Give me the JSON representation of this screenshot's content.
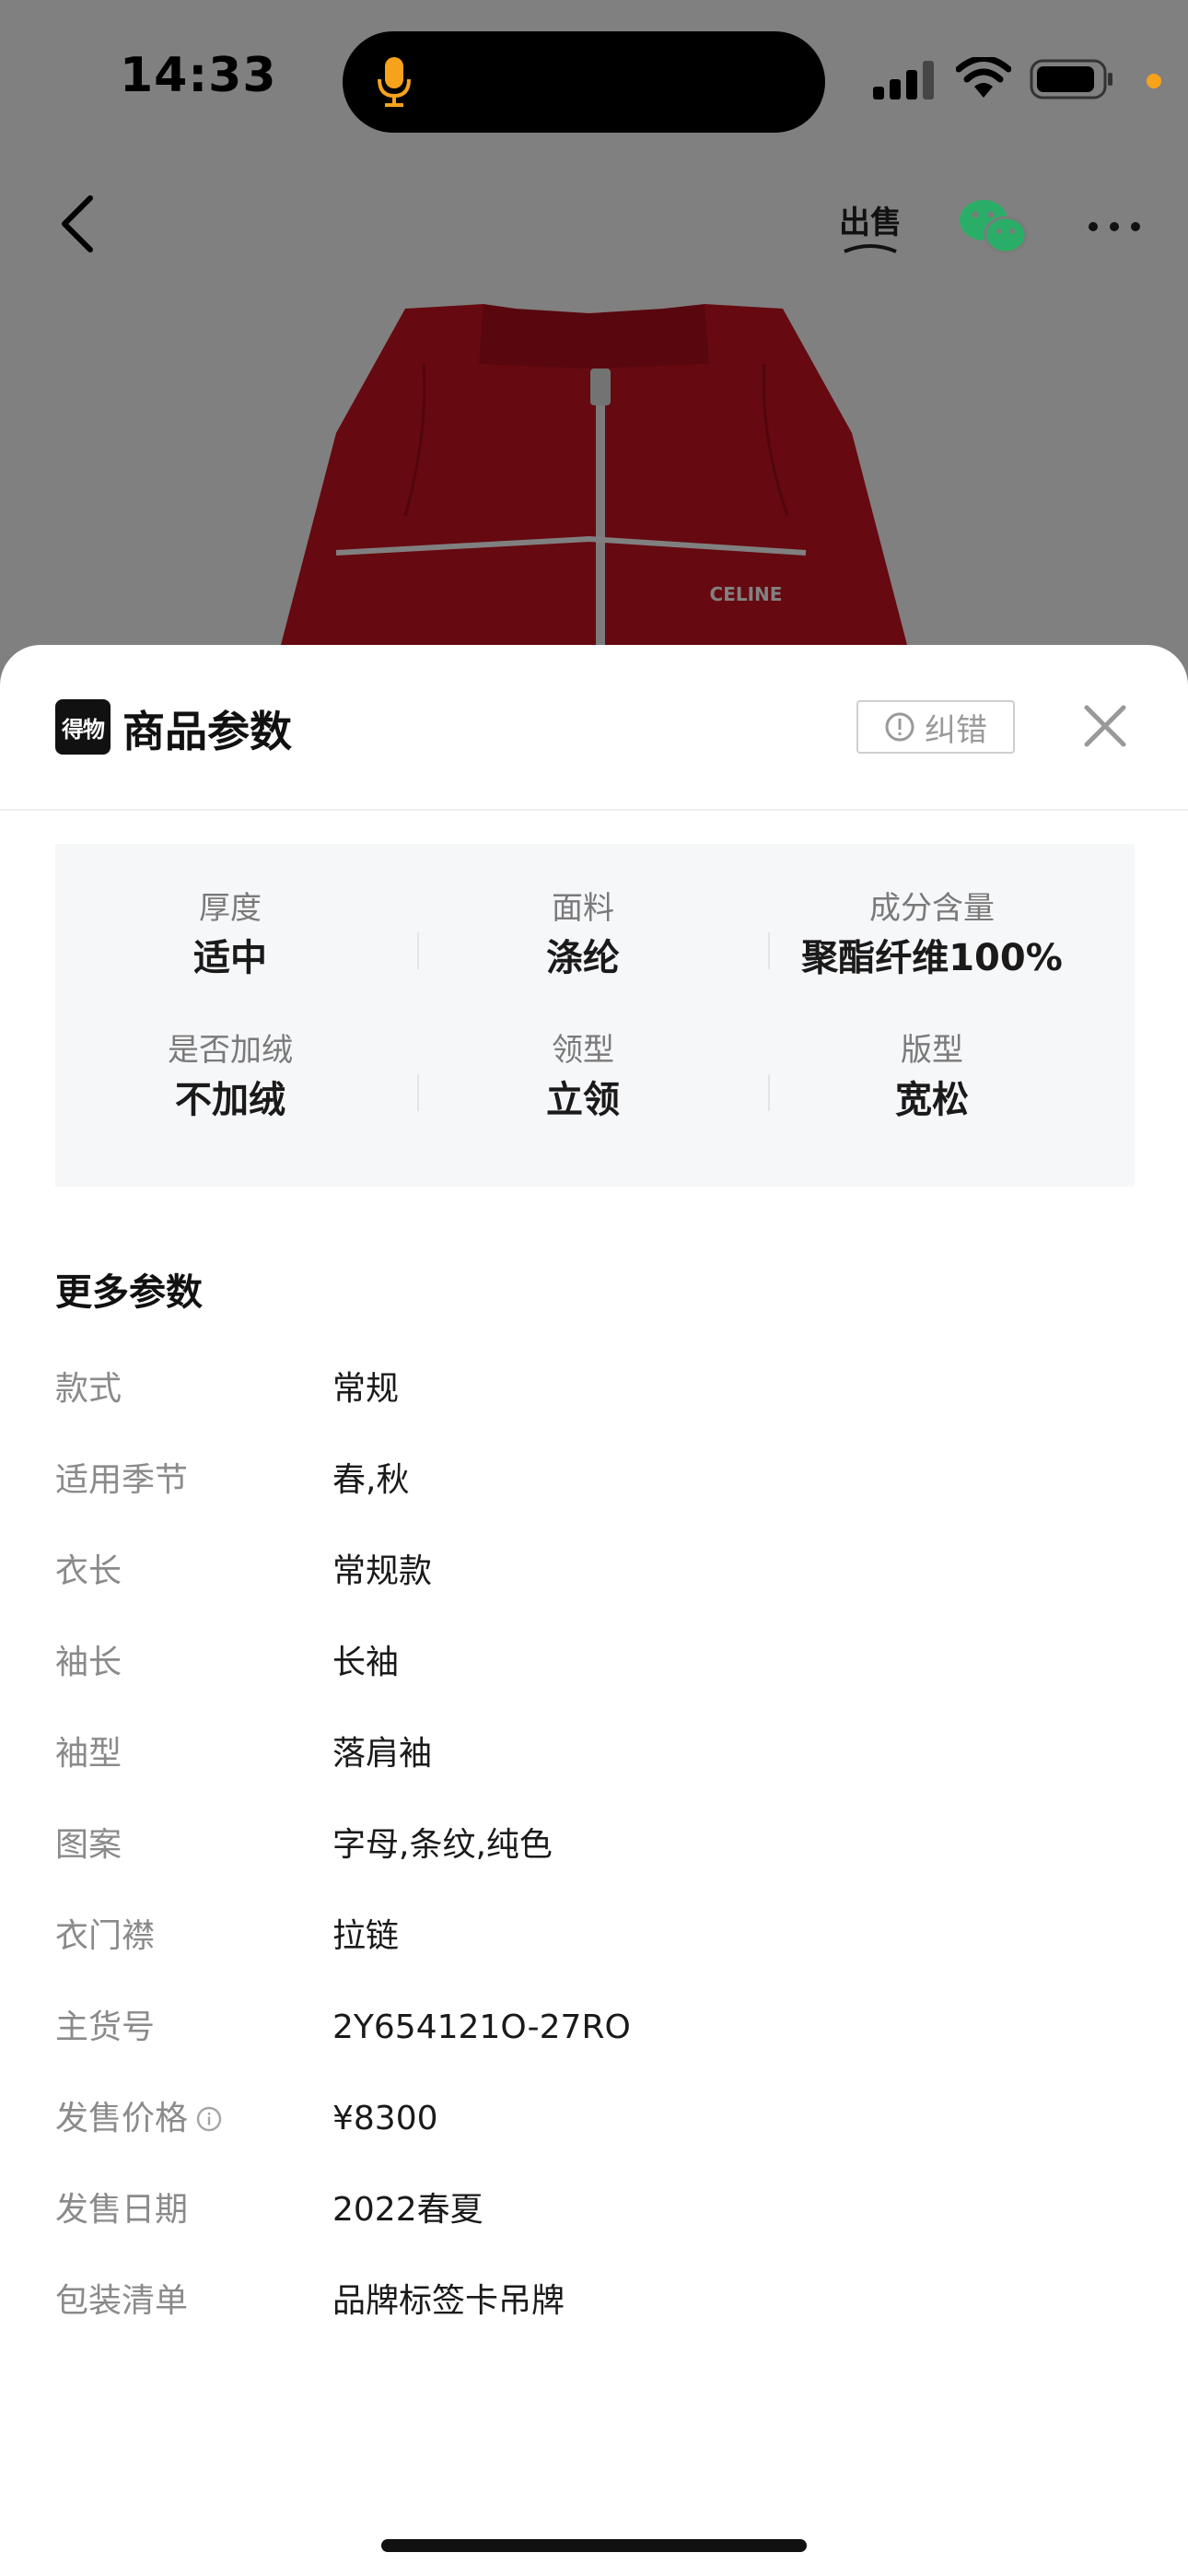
{
  "status_bar": {
    "time": "14:33"
  },
  "product_image": {
    "brand_text": "CELINE",
    "jacket_color": "#c0111f"
  },
  "nav": {
    "back_icon": "chevron-left-icon",
    "sell_label": "出售",
    "wechat_icon": "wechat-icon",
    "more_icon": "more-icon"
  },
  "sheet": {
    "logo_text": "得物",
    "title": "商品参数",
    "report_label": "纠错",
    "close_icon": "close-icon",
    "key_params": [
      {
        "label": "厚度",
        "value": "适中"
      },
      {
        "label": "面料",
        "value": "涤纶"
      },
      {
        "label": "成分含量",
        "value": "聚酯纤维100%"
      },
      {
        "label": "是否加绒",
        "value": "不加绒"
      },
      {
        "label": "领型",
        "value": "立领"
      },
      {
        "label": "版型",
        "value": "宽松"
      }
    ],
    "more_title": "更多参数",
    "params": [
      {
        "label": "款式",
        "value": "常规"
      },
      {
        "label": "适用季节",
        "value": "春,秋"
      },
      {
        "label": "衣长",
        "value": "常规款"
      },
      {
        "label": "袖长",
        "value": "长袖"
      },
      {
        "label": "袖型",
        "value": "落肩袖"
      },
      {
        "label": "图案",
        "value": "字母,条纹,纯色"
      },
      {
        "label": "衣门襟",
        "value": "拉链"
      },
      {
        "label": "主货号",
        "value": "2Y654121O-27RO"
      },
      {
        "label": "发售价格",
        "value": "¥8300"
      },
      {
        "label": "发售日期",
        "value": "2022春夏"
      },
      {
        "label": "包装清单",
        "value": "品牌标签卡吊牌"
      }
    ]
  },
  "colors": {
    "accent_orange": "#f6a31b",
    "wechat_green": "#2aae67"
  }
}
